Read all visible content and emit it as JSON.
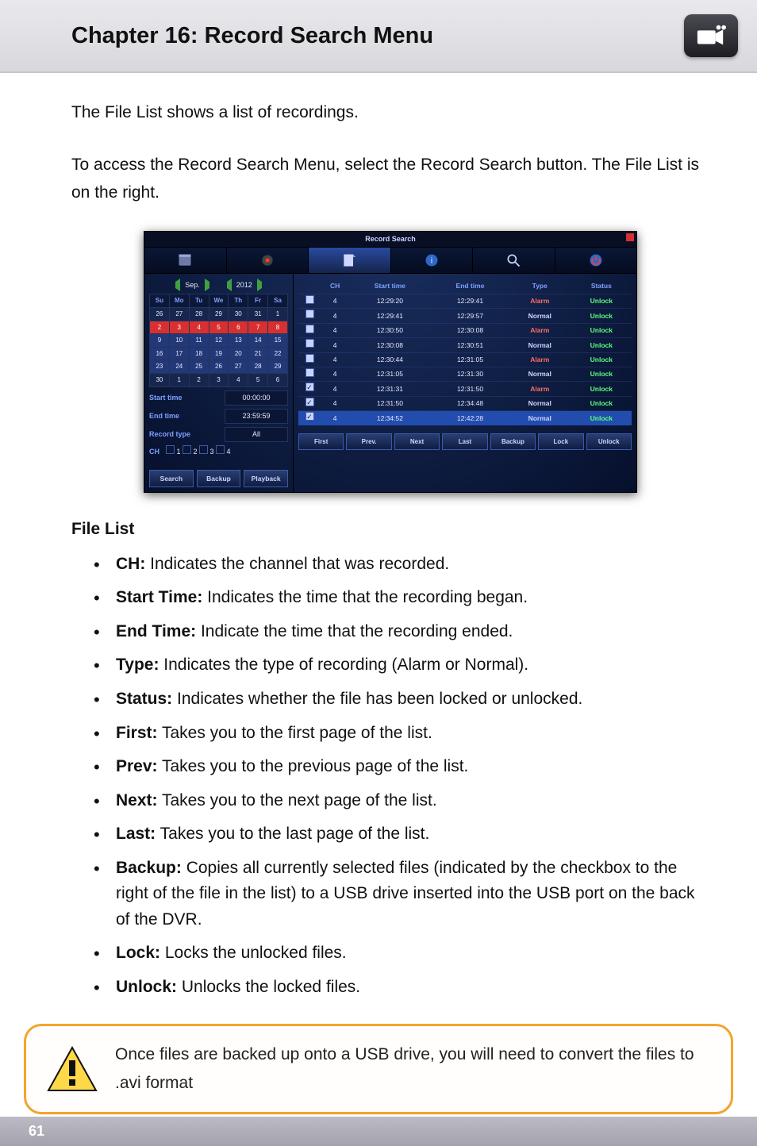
{
  "header": {
    "title": "Chapter 16: Record Search Menu"
  },
  "intro": {
    "p1": "The File List shows a list of recordings.",
    "p2": "To access the Record Search Menu, select the Record Search button. The File List is on the right."
  },
  "dvr": {
    "title": "Record Search",
    "month_label": "Sep.",
    "year_label": "2012",
    "week_days": [
      "Su",
      "Mo",
      "Tu",
      "We",
      "Th",
      "Fr",
      "Sa"
    ],
    "calendar_rows": [
      [
        "26",
        "27",
        "28",
        "29",
        "30",
        "31",
        "1"
      ],
      [
        "2",
        "3",
        "4",
        "5",
        "6",
        "7",
        "8"
      ],
      [
        "9",
        "10",
        "11",
        "12",
        "13",
        "14",
        "15"
      ],
      [
        "16",
        "17",
        "18",
        "19",
        "20",
        "21",
        "22"
      ],
      [
        "23",
        "24",
        "25",
        "26",
        "27",
        "28",
        "29"
      ],
      [
        "30",
        "1",
        "2",
        "3",
        "4",
        "5",
        "6"
      ]
    ],
    "left_fields": {
      "start_time_label": "Start time",
      "start_time_value": "00:00:00",
      "end_time_label": "End time",
      "end_time_value": "23:59:59",
      "record_type_label": "Record type",
      "record_type_value": "All",
      "ch_label": "CH",
      "ch_opts": [
        "1",
        "2",
        "3",
        "4"
      ]
    },
    "left_buttons": {
      "search": "Search",
      "backup": "Backup",
      "playback": "Playback"
    },
    "table_headers": [
      "",
      "CH",
      "Start time",
      "End time",
      "Type",
      "Status"
    ],
    "rows": [
      {
        "checked": false,
        "ch": "4",
        "start": "12:29:20",
        "end": "12:29:41",
        "type": "Alarm",
        "status": "Unlock",
        "sel": false
      },
      {
        "checked": false,
        "ch": "4",
        "start": "12:29:41",
        "end": "12:29:57",
        "type": "Normal",
        "status": "Unlock",
        "sel": false
      },
      {
        "checked": false,
        "ch": "4",
        "start": "12:30:50",
        "end": "12:30:08",
        "type": "Alarm",
        "status": "Unlock",
        "sel": false
      },
      {
        "checked": false,
        "ch": "4",
        "start": "12:30:08",
        "end": "12:30:51",
        "type": "Normal",
        "status": "Unlock",
        "sel": false
      },
      {
        "checked": false,
        "ch": "4",
        "start": "12:30:44",
        "end": "12:31:05",
        "type": "Alarm",
        "status": "Unlock",
        "sel": false
      },
      {
        "checked": false,
        "ch": "4",
        "start": "12:31:05",
        "end": "12:31:30",
        "type": "Normal",
        "status": "Unlock",
        "sel": false
      },
      {
        "checked": true,
        "ch": "4",
        "start": "12:31:31",
        "end": "12:31:50",
        "type": "Alarm",
        "status": "Unlock",
        "sel": false
      },
      {
        "checked": true,
        "ch": "4",
        "start": "12:31:50",
        "end": "12:34:48",
        "type": "Normal",
        "status": "Unlock",
        "sel": false
      },
      {
        "checked": true,
        "ch": "4",
        "start": "12:34:52",
        "end": "12:42:28",
        "type": "Normal",
        "status": "Unlock",
        "sel": true
      }
    ],
    "bottom_buttons": {
      "first": "First",
      "prev": "Prev.",
      "next": "Next",
      "last": "Last",
      "backup": "Backup",
      "lock": "Lock",
      "unlock": "Unlock"
    }
  },
  "file_list_heading": "File List",
  "definitions": [
    {
      "term": "CH:",
      "text": " Indicates the channel that was recorded."
    },
    {
      "term": "Start Time:",
      "text": " Indicates the time that the recording began."
    },
    {
      "term": "End Time:",
      "text": " Indicate the time that the recording ended."
    },
    {
      "term": "Type:",
      "text": " Indicates the type of recording (Alarm or Normal)."
    },
    {
      "term": "Status:",
      "text": " Indicates whether the file has been locked or unlocked."
    },
    {
      "term": "First:",
      "text": " Takes you to the first page of the list."
    },
    {
      "term": "Prev:",
      "text": " Takes you to the previous page of the list."
    },
    {
      "term": "Next:",
      "text": " Takes you to the next page of the list."
    },
    {
      "term": "Last:",
      "text": " Takes you to the last page of the list."
    },
    {
      "term": "Backup:",
      "text": " Copies all currently selected files (indicated by the checkbox to the right of the file in the list) to a USB drive inserted into the USB port on the back of the DVR."
    },
    {
      "term": "Lock:",
      "text": " Locks the unlocked files."
    },
    {
      "term": "Unlock:",
      "text": " Unlocks the locked files."
    }
  ],
  "note": {
    "text": "Once files are backed up onto a USB drive, you will need to convert the files to .avi format"
  },
  "footer": {
    "page": "61"
  }
}
